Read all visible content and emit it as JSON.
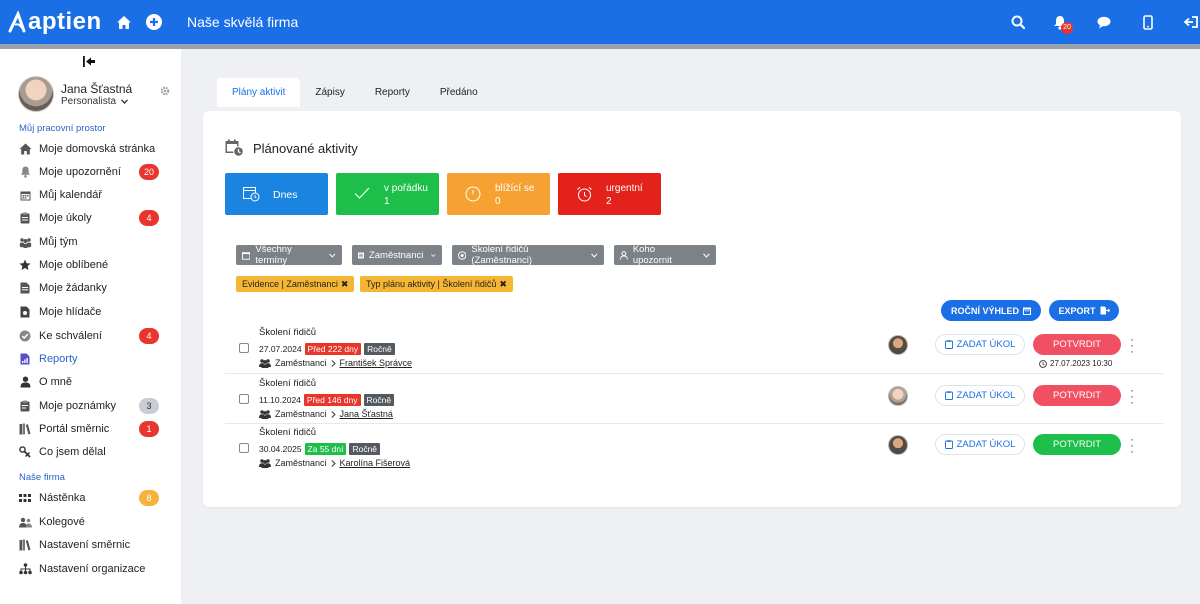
{
  "header": {
    "logo_text": "aptien",
    "company": "Naše skvělá firma",
    "notifications_count": "20",
    "icons": [
      "home-icon",
      "plus-icon",
      "search-icon",
      "bell-icon",
      "chat-icon",
      "phone-icon",
      "logout-icon"
    ],
    "color": "#1a6fe6"
  },
  "user": {
    "name": "Jana Šťastná",
    "role": "Personalista"
  },
  "sidebar": {
    "section_workspace": "Můj pracovní prostor",
    "section_company": "Naše firma",
    "workspace_items": [
      {
        "label": "Moje domovská stránka",
        "icon": "home-icon"
      },
      {
        "label": "Moje upozornění",
        "icon": "bell-icon",
        "badge": "20"
      },
      {
        "label": "Můj kalendář",
        "icon": "calendar-icon"
      },
      {
        "label": "Moje úkoly",
        "icon": "clipboard-icon",
        "badge": "4"
      },
      {
        "label": "Můj tým",
        "icon": "team-icon"
      },
      {
        "label": "Moje oblíbené",
        "icon": "star-icon"
      },
      {
        "label": "Moje žádanky",
        "icon": "request-icon"
      },
      {
        "label": "Moje hlídače",
        "icon": "watch-icon"
      },
      {
        "label": "Ke schválení",
        "icon": "check-icon",
        "badge": "4"
      },
      {
        "label": "Reporty",
        "icon": "report-icon"
      },
      {
        "label": "O mně",
        "icon": "user-icon"
      },
      {
        "label": "Moje poznámky",
        "icon": "notes-icon",
        "badge": "3"
      },
      {
        "label": "Portál směrnic",
        "icon": "books-icon",
        "badge": "1"
      },
      {
        "label": "Co jsem dělal",
        "icon": "history-icon"
      }
    ],
    "company_items": [
      {
        "label": "Nástěnka",
        "icon": "board-icon",
        "badge": "8"
      },
      {
        "label": "Kolegové",
        "icon": "colleagues-icon"
      },
      {
        "label": "Nastavení směrnic",
        "icon": "books-icon"
      },
      {
        "label": "Nastavení organizace",
        "icon": "org-icon"
      }
    ]
  },
  "tabs": [
    "Plány aktivit",
    "Zápisy",
    "Reporty",
    "Předáno"
  ],
  "card": {
    "title": "Plánované aktivity",
    "tiles": [
      {
        "label": "Dnes",
        "value": "",
        "color": "#1a84e0"
      },
      {
        "label": "v pořádku",
        "value": "1",
        "color": "#1dbf4a"
      },
      {
        "label": "blížící se",
        "value": "0",
        "color": "#f6a232"
      },
      {
        "label": "urgentní",
        "value": "2",
        "color": "#e3221b"
      }
    ],
    "filters": [
      "Všechny termíny",
      "Zaměstnanci",
      "Školení řidičů (Zaměstnanci)",
      "Koho upozornit"
    ],
    "chips": [
      "Evidence | Zaměstnanci",
      "Typ plánu aktivity | Školení řidičů"
    ],
    "year_view": "ROČNÍ VÝHLED",
    "export": "EXPORT",
    "task_label": "ZADAT ÚKOL",
    "confirm_label": "POTVRDIT",
    "rows": [
      {
        "title": "Školení řidičů",
        "date": "27.07.2024",
        "status": "Před 222 dny",
        "status_color": "red",
        "freq": "Ročně",
        "group": "Zaměstnanci",
        "person": "František Správce",
        "confirm_color": "red",
        "confirmed_at": "27.07.2023 10:30"
      },
      {
        "title": "Školení řidičů",
        "date": "11.10.2024",
        "status": "Před 146 dny",
        "status_color": "red",
        "freq": "Ročně",
        "group": "Zaměstnanci",
        "person": "Jana Šťastná",
        "confirm_color": "red",
        "confirmed_at": ""
      },
      {
        "title": "Školení řidičů",
        "date": "30.04.2025",
        "status": "Za 55 dní",
        "status_color": "green",
        "freq": "Ročně",
        "group": "Zaměstnanci",
        "person": "Karolína Fišerová",
        "confirm_color": "green",
        "confirmed_at": ""
      }
    ]
  }
}
